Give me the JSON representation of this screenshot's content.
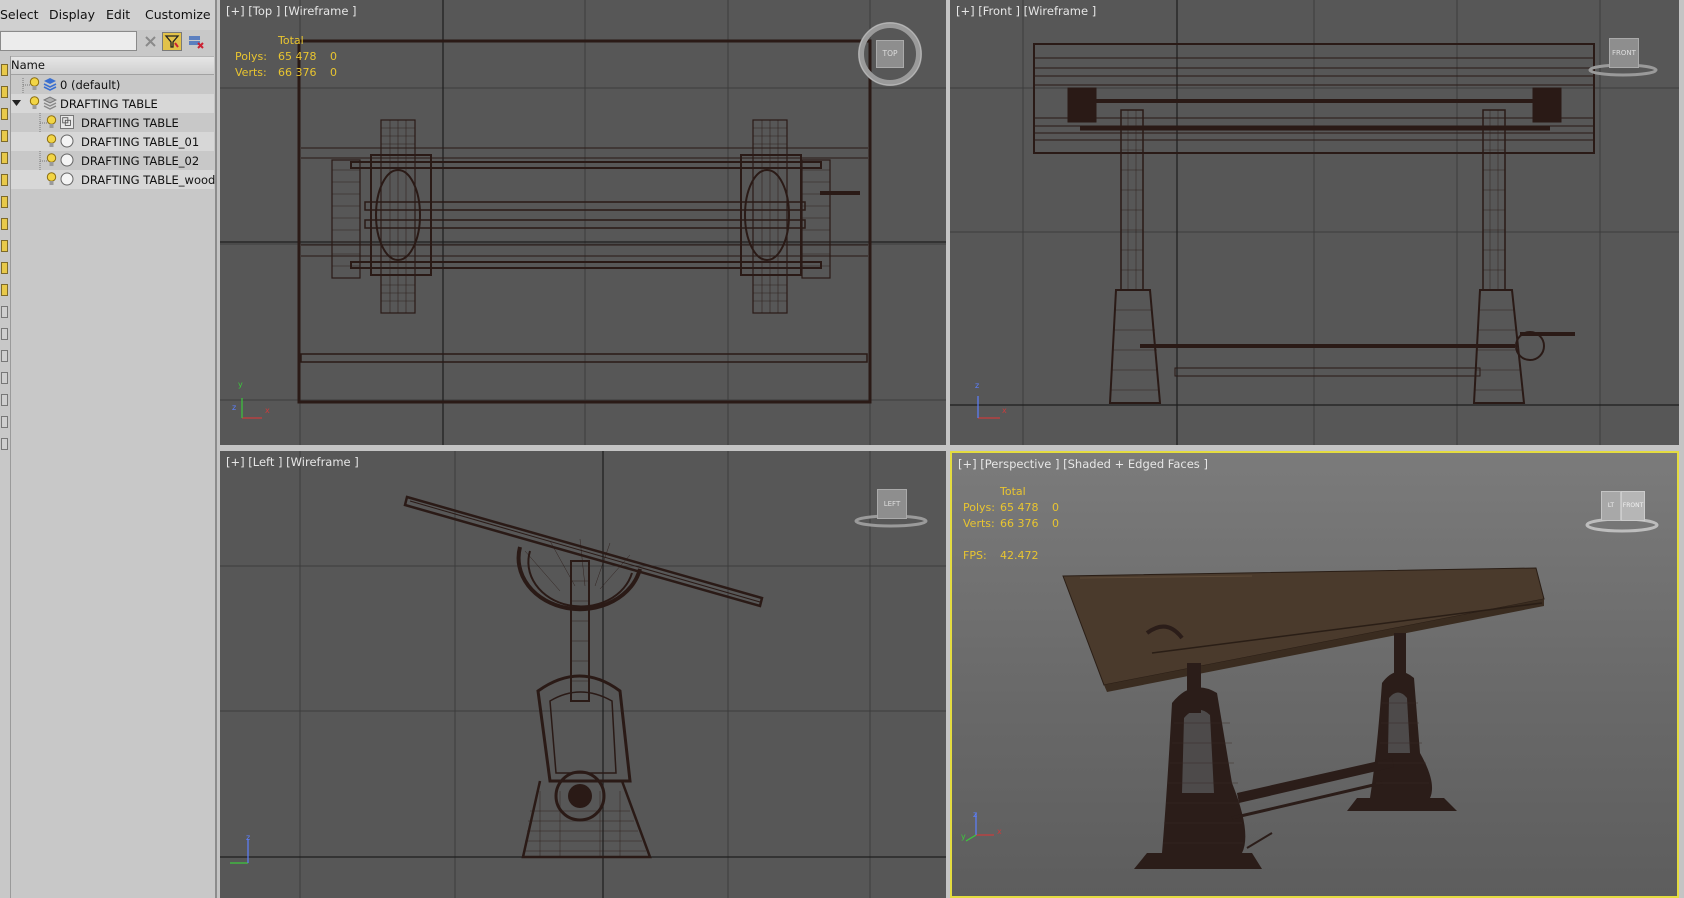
{
  "menu": {
    "select": "Select",
    "display": "Display",
    "edit": "Edit",
    "customize": "Customize"
  },
  "explorer": {
    "search_value": "",
    "column_header": "Name",
    "rows": [
      {
        "label": "0 (default)",
        "type": "layer-default"
      },
      {
        "label": "DRAFTING TABLE",
        "type": "layer"
      },
      {
        "label": "DRAFTING TABLE",
        "type": "object"
      },
      {
        "label": "DRAFTING TABLE_01",
        "type": "object"
      },
      {
        "label": "DRAFTING TABLE_02",
        "type": "object"
      },
      {
        "label": "DRAFTING TABLE_wood",
        "type": "object"
      }
    ]
  },
  "viewports": {
    "top": {
      "label": "[+] [Top ] [Wireframe ]",
      "stats": {
        "total": "Total",
        "polys_label": "Polys:",
        "polys": "65 478",
        "polys_sel": "0",
        "verts_label": "Verts:",
        "verts": "66 376",
        "verts_sel": "0"
      },
      "cube": "TOP"
    },
    "front": {
      "label": "[+] [Front ] [Wireframe ]",
      "cube": "FRONT"
    },
    "left": {
      "label": "[+] [Left ] [Wireframe ]",
      "cube": "LEFT"
    },
    "perspective": {
      "label": "[+] [Perspective ] [Shaded + Edged Faces ]",
      "stats": {
        "total": "Total",
        "polys_label": "Polys:",
        "polys": "65 478",
        "polys_sel": "0",
        "verts_label": "Verts:",
        "verts": "66 376",
        "verts_sel": "0",
        "fps_label": "FPS:",
        "fps": "42.472"
      },
      "cube_left": "LT",
      "cube_front": "FRONT"
    }
  },
  "colors": {
    "viewport_bg": "#575757",
    "wire": "#2a1a16",
    "stats": "#e9c530",
    "active_border": "#e4dc40",
    "wood": "#4a3a2c"
  },
  "axis": {
    "x": "x",
    "y": "y",
    "z": "z"
  }
}
